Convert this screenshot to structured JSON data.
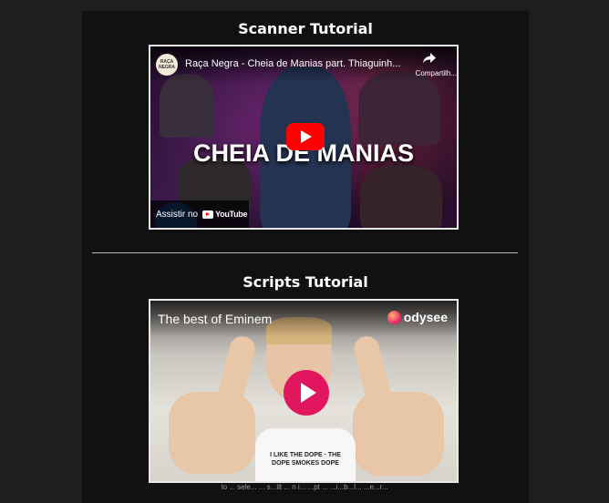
{
  "sections": [
    {
      "title": "Scanner Tutorial",
      "video": {
        "provider": "YouTube",
        "channel_logo_text": "RAÇA NEGRA",
        "title": "Raça Negra - Cheia de Manias part. Thiaguinh...",
        "share_label": "Compartilh...",
        "overlay_text": "CHEIA DE MANIAS",
        "watch_label": "Assistir no",
        "platform_name": "YouTube"
      }
    },
    {
      "title": "Scripts Tutorial",
      "video": {
        "provider": "odysee",
        "title": "The best of Eminem",
        "platform_name": "odysee",
        "shirt_text": "I LIKE THE DOPE · THE DOPE SMOKES DOPE"
      }
    }
  ],
  "footer": {
    "text": "to ... sele... ... s...ilt ... n i... ...pt ... ...i...b...l... ...e...r..."
  },
  "colors": {
    "page_bg": "#1e1e1e",
    "panel_bg": "#111111",
    "youtube_red": "#ff0000",
    "odysee_pink": "#e2165e"
  }
}
